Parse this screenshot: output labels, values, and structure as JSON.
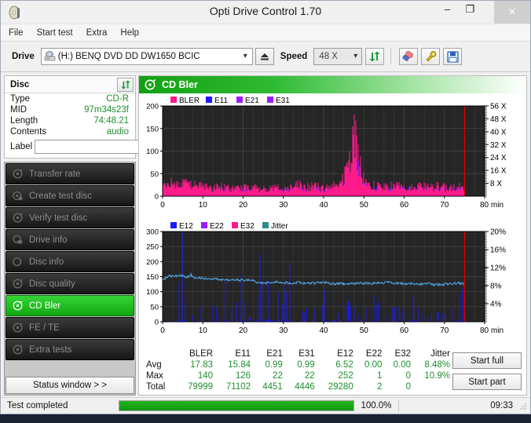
{
  "window": {
    "title": "Opti Drive Control 1.70",
    "app_icon": "disc-icon",
    "minimize": "–",
    "maximize": "❐",
    "close": "×"
  },
  "menu": {
    "items": [
      {
        "label": "File"
      },
      {
        "label": "Start test"
      },
      {
        "label": "Extra"
      },
      {
        "label": "Help"
      }
    ]
  },
  "drivebar": {
    "drive_label": "Drive",
    "drive_value": "(H:)   BENQ DVD DD DW1650 BCIC",
    "speed_label": "Speed",
    "speed_value": "48 X",
    "eject_icon": "eject-icon",
    "refresh_icon": "refresh-icon",
    "erase_icon": "eraser-icon",
    "tools_icon": "wrench-icon",
    "save_icon": "floppy-save-icon"
  },
  "disc": {
    "title": "Disc",
    "refresh_icon": "refresh-icon",
    "rows": [
      {
        "key": "Type",
        "value": "CD-R"
      },
      {
        "key": "MID",
        "value": "97m34s23f"
      },
      {
        "key": "Length",
        "value": "74:48.21"
      },
      {
        "key": "Contents",
        "value": "audio"
      }
    ],
    "label_key": "Label",
    "label_value": "",
    "label_placeholder": "",
    "label_button_icon": "cd-disc-icon"
  },
  "sidebar": {
    "items": [
      {
        "label": "Transfer rate",
        "icon": "disc-scan-icon",
        "active": false
      },
      {
        "label": "Create test disc",
        "icon": "disc-write-icon",
        "active": false
      },
      {
        "label": "Verify test disc",
        "icon": "disc-scan-icon",
        "active": false
      },
      {
        "label": "Drive info",
        "icon": "drive-info-icon",
        "active": false
      },
      {
        "label": "Disc info",
        "icon": "disc-info-icon",
        "active": false
      },
      {
        "label": "Disc quality",
        "icon": "disc-scan-icon",
        "active": false
      },
      {
        "label": "CD Bler",
        "icon": "disc-scan-icon",
        "active": true
      },
      {
        "label": "FE / TE",
        "icon": "disc-scan-icon",
        "active": false
      },
      {
        "label": "Extra tests",
        "icon": "disc-scan-icon",
        "active": false
      }
    ],
    "status_window_label": "Status window > >"
  },
  "panel": {
    "title": "CD Bler",
    "icon": "disc-scan-icon"
  },
  "chart_data": [
    {
      "type": "line",
      "name": "cd-bler-errors",
      "title": "CD Bler",
      "xlabel": "min",
      "ylabel": "",
      "xlim": [
        0,
        80
      ],
      "ylim": [
        0,
        200
      ],
      "xticks": [
        0,
        10,
        20,
        30,
        40,
        50,
        60,
        70,
        80
      ],
      "xticklabels": [
        "0",
        "10",
        "20",
        "30",
        "40",
        "50",
        "60",
        "70",
        "80 min"
      ],
      "yticks": [
        0,
        50,
        100,
        150,
        200
      ],
      "yticklabels": [
        "0",
        "50",
        "100",
        "150",
        "200"
      ],
      "y2ticks": [
        8,
        16,
        24,
        32,
        40,
        48,
        56
      ],
      "y2ticklabels": [
        "8 X",
        "16 X",
        "24 X",
        "32 X",
        "40 X",
        "48 X",
        "56 X"
      ],
      "y2lim": [
        0,
        56
      ],
      "grid": true,
      "background": "#262626",
      "legend": [
        {
          "label": "BLER",
          "color": "#ff1a8c"
        },
        {
          "label": "E11",
          "color": "#1a1aff"
        },
        {
          "label": "E21",
          "color": "#9d1aff"
        },
        {
          "label": "E31",
          "color": "#9d1aff"
        }
      ],
      "scan_end_marker_min": 75,
      "scan_end_marker_color": "#e00000",
      "series": [
        {
          "name": "BLER",
          "color": "#ff1a8c",
          "x": [
            0,
            2,
            4,
            6,
            8,
            10,
            12,
            14,
            16,
            18,
            20,
            22,
            24,
            26,
            28,
            30,
            32,
            34,
            36,
            38,
            40,
            42,
            44,
            45,
            46,
            47,
            47.5,
            48,
            48.5,
            49,
            49.5,
            50,
            51,
            52,
            54,
            56,
            58,
            60,
            62,
            64,
            66,
            68,
            70,
            72,
            74,
            75
          ],
          "values": [
            26,
            30,
            24,
            33,
            26,
            22,
            18,
            25,
            20,
            17,
            19,
            22,
            16,
            18,
            22,
            17,
            19,
            28,
            21,
            26,
            18,
            22,
            30,
            45,
            70,
            118,
            140,
            132,
            110,
            78,
            52,
            38,
            30,
            26,
            24,
            22,
            25,
            20,
            22,
            24,
            20,
            23,
            21,
            19,
            22,
            18
          ]
        },
        {
          "name": "E11",
          "color": "#1a1aff",
          "x": [
            0,
            2,
            4,
            6,
            8,
            10,
            12,
            14,
            16,
            18,
            20,
            22,
            24,
            26,
            28,
            30,
            32,
            34,
            36,
            38,
            40,
            42,
            44,
            45,
            46,
            47,
            47.5,
            48,
            48.5,
            49,
            49.5,
            50,
            51,
            52,
            54,
            56,
            58,
            60,
            62,
            64,
            66,
            68,
            70,
            72,
            74,
            75
          ],
          "values": [
            16,
            18,
            15,
            17,
            16,
            14,
            12,
            15,
            13,
            12,
            13,
            14,
            11,
            12,
            14,
            12,
            13,
            16,
            14,
            16,
            13,
            14,
            18,
            28,
            45,
            78,
            96,
            92,
            78,
            56,
            40,
            28,
            22,
            19,
            17,
            16,
            18,
            15,
            16,
            17,
            15,
            16,
            15,
            14,
            16,
            13
          ]
        },
        {
          "name": "E21",
          "color": "#9d1aff",
          "x": [
            0,
            10,
            20,
            30,
            40,
            45,
            48,
            50,
            55,
            60,
            65,
            70,
            75
          ],
          "values": [
            1,
            1,
            1,
            1,
            1,
            2,
            6,
            3,
            2,
            2,
            2,
            2,
            1
          ]
        },
        {
          "name": "E31",
          "color": "#9d1aff",
          "x": [
            0,
            10,
            20,
            30,
            40,
            45,
            48,
            50,
            55,
            60,
            65,
            70,
            75
          ],
          "values": [
            1,
            1,
            1,
            1,
            1,
            2,
            6,
            3,
            2,
            2,
            2,
            2,
            1
          ]
        }
      ]
    },
    {
      "type": "line",
      "name": "cd-bler-e12-jitter",
      "title": "",
      "xlabel": "min",
      "ylabel": "",
      "xlim": [
        0,
        80
      ],
      "ylim": [
        0,
        300
      ],
      "xticks": [
        0,
        10,
        20,
        30,
        40,
        50,
        60,
        70,
        80
      ],
      "xticklabels": [
        "0",
        "10",
        "20",
        "30",
        "40",
        "50",
        "60",
        "70",
        "80 min"
      ],
      "yticks": [
        0,
        50,
        100,
        150,
        200,
        250,
        300
      ],
      "yticklabels": [
        "0",
        "50",
        "100",
        "150",
        "200",
        "250",
        "300"
      ],
      "y2ticks": [
        4,
        8,
        12,
        16,
        20
      ],
      "y2ticklabels": [
        "4%",
        "8%",
        "12%",
        "16%",
        "20%"
      ],
      "y2lim": [
        0,
        20
      ],
      "grid": true,
      "background": "#262626",
      "legend": [
        {
          "label": "E12",
          "color": "#1a1aff"
        },
        {
          "label": "E22",
          "color": "#9d1aff"
        },
        {
          "label": "E32",
          "color": "#ff1a8c"
        },
        {
          "label": "Jitter",
          "color": "#2e8b8b"
        }
      ],
      "scan_end_marker_min": 75,
      "scan_end_marker_color": "#e00000",
      "series": [
        {
          "name": "Jitter",
          "color": "#4fa8e8",
          "unit": "percent",
          "x": [
            0,
            1,
            2,
            3,
            4,
            5,
            6,
            7,
            8,
            9,
            10,
            12,
            14,
            16,
            18,
            20,
            22,
            24,
            26,
            28,
            30,
            32,
            34,
            36,
            38,
            40,
            42,
            44,
            46,
            48,
            50,
            52,
            54,
            56,
            58,
            60,
            62,
            64,
            66,
            68,
            70,
            72,
            74,
            75
          ],
          "values": [
            9.2,
            10.0,
            10.2,
            10.1,
            10.3,
            10.2,
            9.9,
            10.4,
            9.7,
            9.8,
            9.6,
            9.5,
            9.4,
            9.3,
            9.3,
            9.2,
            9.2,
            8.7,
            8.6,
            8.8,
            8.7,
            8.6,
            8.7,
            8.5,
            8.6,
            8.8,
            8.4,
            8.5,
            8.3,
            8.5,
            8.6,
            8.4,
            8.6,
            8.7,
            8.5,
            8.4,
            8.5,
            8.3,
            8.4,
            8.2,
            8.3,
            8.5,
            8.6,
            8.4
          ]
        },
        {
          "name": "E12",
          "color": "#1a1aff",
          "x": [
            1,
            2,
            3,
            5,
            6,
            8,
            9,
            11,
            13,
            14,
            16,
            18,
            19,
            21,
            22,
            24,
            26,
            27,
            28,
            30,
            31,
            33,
            34,
            36,
            38,
            40,
            42,
            44,
            46,
            48,
            50,
            52,
            54,
            56,
            58,
            60,
            62,
            64,
            66,
            68,
            70,
            72,
            74
          ],
          "values": [
            20,
            110,
            15,
            252,
            30,
            18,
            95,
            25,
            60,
            15,
            130,
            12,
            150,
            18,
            22,
            180,
            145,
            160,
            120,
            40,
            200,
            25,
            60,
            30,
            35,
            70,
            140,
            20,
            120,
            35,
            28,
            90,
            40,
            25,
            60,
            30,
            180,
            40,
            20,
            35,
            25,
            45,
            100
          ]
        },
        {
          "name": "E22",
          "color": "#9d1aff",
          "x": [
            0,
            40,
            75
          ],
          "values": [
            0,
            1,
            0
          ]
        },
        {
          "name": "E32",
          "color": "#ff1a8c",
          "x": [
            0,
            40,
            75
          ],
          "values": [
            0,
            0,
            0
          ]
        }
      ]
    }
  ],
  "stats": {
    "columns": [
      "BLER",
      "E11",
      "E21",
      "E31",
      "E12",
      "E22",
      "E32",
      "Jitter"
    ],
    "rows": [
      {
        "label": "Avg",
        "values": [
          "17.83",
          "15.84",
          "0.99",
          "0.99",
          "6.52",
          "0.00",
          "0.00",
          "8.48%"
        ]
      },
      {
        "label": "Max",
        "values": [
          "140",
          "126",
          "22",
          "22",
          "252",
          "1",
          "0",
          "10.9%"
        ]
      },
      {
        "label": "Total",
        "values": [
          "79999",
          "71102",
          "4451",
          "4446",
          "29280",
          "2",
          "0",
          ""
        ]
      }
    ]
  },
  "actions": {
    "start_full": "Start full",
    "start_part": "Start part"
  },
  "statusbar": {
    "text": "Test completed",
    "progress_pct": "100.0%",
    "progress_value": 100,
    "time": "09:33"
  },
  "colors": {
    "accent_green": "#12a013",
    "value_green": "#1f8f2f",
    "bler_pink": "#ff1a8c",
    "e11_blue": "#1a1aff",
    "e21_purple": "#9d1aff",
    "jitter_teal": "#2e8b8b",
    "chart_bg": "#262626",
    "marker_red": "#e00000"
  }
}
